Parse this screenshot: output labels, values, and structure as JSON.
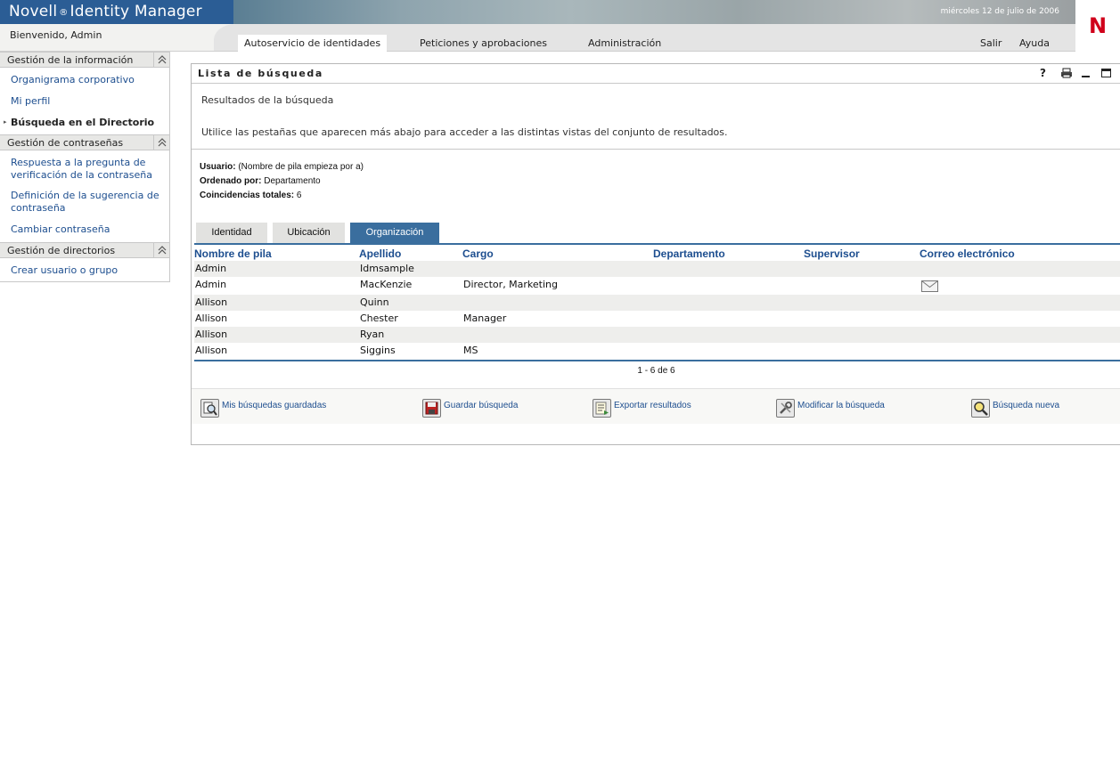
{
  "header": {
    "brand_name": "Novell",
    "brand_reg": "®",
    "brand_product": "Identity Manager",
    "date": "miércoles 12 de julio de 2006",
    "logo_letter": "N",
    "welcome": "Bienvenido, Admin",
    "tabs": [
      {
        "label": "Autoservicio de identidades",
        "active": true
      },
      {
        "label": "Peticiones y aprobaciones",
        "active": false
      },
      {
        "label": "Administración",
        "active": false
      }
    ],
    "logout": "Salir",
    "help": "Ayuda"
  },
  "sidebar": {
    "sections": [
      {
        "title": "Gestión de la información",
        "items": [
          "Organigrama corporativo",
          "Mi perfil",
          "Búsqueda en el Directorio"
        ]
      },
      {
        "title": "Gestión de contraseñas",
        "items": [
          "Respuesta a la pregunta de verificación de la contraseña",
          "Definición de la sugerencia de contraseña",
          "Cambiar contraseña"
        ]
      },
      {
        "title": "Gestión de directorios",
        "items": [
          "Crear usuario o grupo"
        ]
      }
    ],
    "current_item": "Búsqueda en el Directorio"
  },
  "portlet": {
    "title": "Lista de búsqueda",
    "controls": {
      "help": "?"
    },
    "heading": "Resultados de la búsqueda",
    "instructions": "Utilice las pestañas que aparecen más abajo para acceder a las distintas vistas del conjunto de resultados.",
    "criteria": {
      "user_label": "Usuario:",
      "user_value": " (Nombre de pila empieza por a)",
      "sort_label": "Ordenado por:",
      "sort_value": " Departamento",
      "total_label": "Coincidencias totales:",
      "total_value": " 6"
    },
    "view_tabs": [
      {
        "label": "Identidad",
        "active": false
      },
      {
        "label": "Ubicación",
        "active": false
      },
      {
        "label": "Organización",
        "active": true
      }
    ],
    "columns": [
      "Nombre de pila",
      "Apellido",
      "Cargo",
      "Departamento",
      "Supervisor",
      "Correo electrónico"
    ],
    "rows": [
      {
        "first": "Admin",
        "last": "Idmsample",
        "title": "",
        "dept": "",
        "supervisor": "",
        "email": false
      },
      {
        "first": "Admin",
        "last": "MacKenzie",
        "title": "Director, Marketing",
        "dept": "",
        "supervisor": "",
        "email": true
      },
      {
        "first": "Allison",
        "last": "Quinn",
        "title": "",
        "dept": "",
        "supervisor": "",
        "email": false
      },
      {
        "first": "Allison",
        "last": "Chester",
        "title": "Manager",
        "dept": "",
        "supervisor": "",
        "email": false
      },
      {
        "first": "Allison",
        "last": "Ryan",
        "title": "",
        "dept": "",
        "supervisor": "",
        "email": false
      },
      {
        "first": "Allison",
        "last": "Siggins",
        "title": "MS",
        "dept": "",
        "supervisor": "",
        "email": false
      }
    ],
    "pager": "1 - 6 de 6",
    "actions": [
      "Mis búsquedas guardadas",
      "Guardar búsqueda",
      "Exportar resultados",
      "Modificar la búsqueda",
      "Búsqueda nueva"
    ]
  },
  "colors": {
    "brand_blue": "#2b5d95",
    "link_blue": "#1d4e8f",
    "tab_active": "#3a6e9e",
    "logo_red": "#d0021b"
  }
}
